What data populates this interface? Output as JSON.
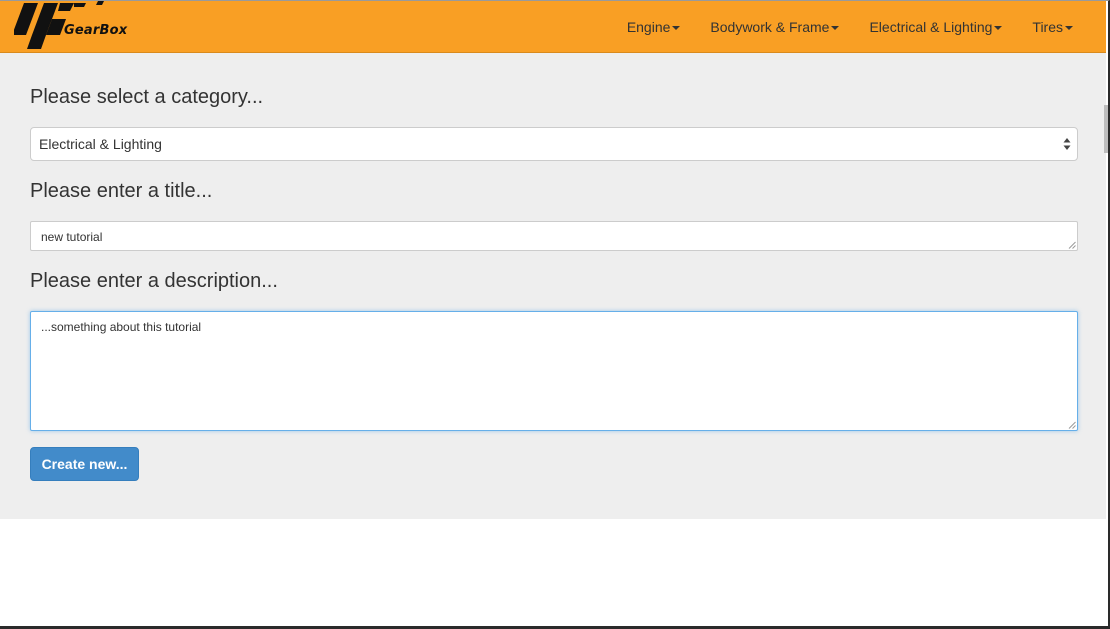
{
  "brand": {
    "name": "GearBox",
    "logo_icon": "checkered-flag-icon"
  },
  "nav": {
    "items": [
      {
        "label": "Engine"
      },
      {
        "label": "Bodywork & Frame"
      },
      {
        "label": "Electrical & Lighting"
      },
      {
        "label": "Tires"
      }
    ]
  },
  "form": {
    "category_label": "Please select a category...",
    "category_value": "Electrical & Lighting",
    "title_label": "Please enter a title...",
    "title_value": "new tutorial",
    "description_label": "Please enter a description...",
    "description_value": "...something about this tutorial",
    "submit_label": "Create new..."
  },
  "colors": {
    "navbar": "#f99f24",
    "content_bg": "#eeeeee",
    "primary": "#428bca",
    "focus": "#66afe9"
  }
}
